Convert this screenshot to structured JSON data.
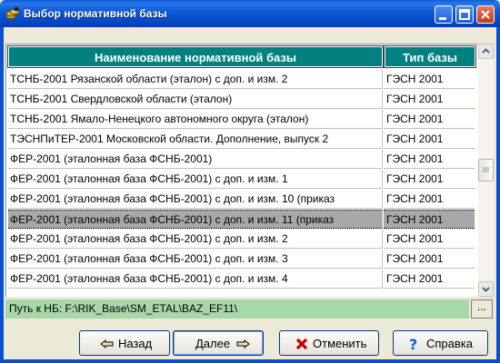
{
  "window": {
    "title": "Выбор нормативной базы"
  },
  "table": {
    "columns": [
      "Наименование нормативной базы",
      "Тип базы"
    ],
    "rows": [
      {
        "name": "ТСНБ-2001 Рязанской области (эталон) с доп. и изм. 2",
        "type": "ГЭСН 2001"
      },
      {
        "name": "ТСНБ-2001 Свердловской области (эталон)",
        "type": "ГЭСН 2001"
      },
      {
        "name": "ТСНБ-2001 Ямало-Ненецкого автономного округа (эталон)",
        "type": "ГЭСН 2001"
      },
      {
        "name": "ТЭСНПиТЕР-2001 Московской области. Дополнение, выпуск 2",
        "type": "ГЭСН 2001"
      },
      {
        "name": "ФЕР-2001 (эталонная база ФСНБ-2001)",
        "type": "ГЭСН 2001"
      },
      {
        "name": "ФЕР-2001 (эталонная база ФСНБ-2001) с доп. и изм. 1",
        "type": "ГЭСН 2001"
      },
      {
        "name": "ФЕР-2001 (эталонная база ФСНБ-2001) с доп. и изм. 10 (приказ",
        "type": "ГЭСН 2001"
      },
      {
        "name": "ФЕР-2001 (эталонная база ФСНБ-2001) с доп. и изм. 11 (приказ",
        "type": "ГЭСН 2001"
      },
      {
        "name": "ФЕР-2001 (эталонная база ФСНБ-2001) с доп. и изм. 2",
        "type": "ГЭСН 2001"
      },
      {
        "name": "ФЕР-2001 (эталонная база ФСНБ-2001) с доп. и изм. 3",
        "type": "ГЭСН 2001"
      },
      {
        "name": "ФЕР-2001 (эталонная база ФСНБ-2001) с доп. и изм. 4",
        "type": "ГЭСН 2001"
      }
    ],
    "selected_row": 7
  },
  "path": {
    "text": "Путь к НБ: F:\\RIK_Base\\SM_ETAL\\BAZ_EF11\\",
    "browse_label": "..."
  },
  "buttons": {
    "back": "Назад",
    "next": "Далее",
    "cancel": "Отменить",
    "help": "Справка"
  },
  "colors": {
    "header_bg": "#00807f",
    "selected_row_bg": "#a8a8a8",
    "path_bg": "#a8d8a8",
    "titlebar": "#0a58d6"
  }
}
